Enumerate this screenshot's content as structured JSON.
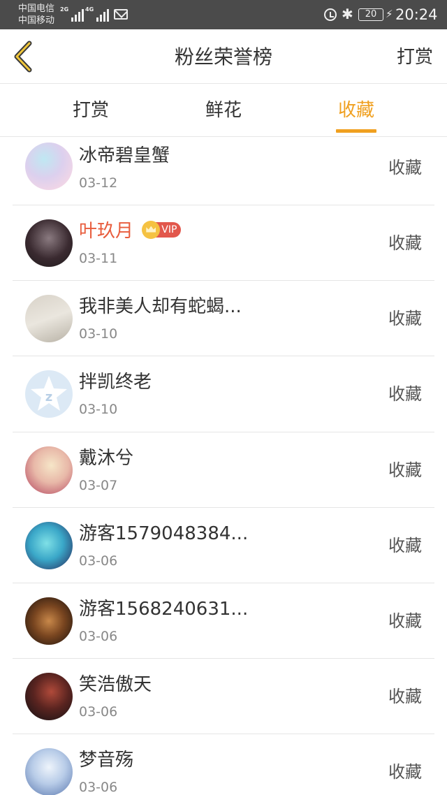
{
  "status_bar": {
    "carrier1": "中国电信",
    "carrier2": "中国移动",
    "net1": "2G",
    "net2": "4G",
    "battery": "20",
    "time": "20:24"
  },
  "header": {
    "title": "粉丝荣誉榜",
    "right_label": "打赏",
    "back_icon": "chevron-left-icon",
    "accent_color": "#f0a020"
  },
  "tabs": [
    {
      "label": "打赏",
      "active": false
    },
    {
      "label": "鲜花",
      "active": false
    },
    {
      "label": "收藏",
      "active": true
    }
  ],
  "list": [
    {
      "name": "冰帝碧皇蟹",
      "date": "03-12",
      "action": "收藏",
      "vip": false
    },
    {
      "name": "叶玖月",
      "date": "03-11",
      "action": "收藏",
      "vip": true,
      "vip_label": "VIP"
    },
    {
      "name": "我非美人却有蛇蝎...",
      "date": "03-10",
      "action": "收藏",
      "vip": false
    },
    {
      "name": "拌凯终老",
      "date": "03-10",
      "action": "收藏",
      "vip": false
    },
    {
      "name": "戴沐兮",
      "date": "03-07",
      "action": "收藏",
      "vip": false
    },
    {
      "name": "游客1579048384...",
      "date": "03-06",
      "action": "收藏",
      "vip": false
    },
    {
      "name": "游客1568240631...",
      "date": "03-06",
      "action": "收藏",
      "vip": false
    },
    {
      "name": "笑浩傲天",
      "date": "03-06",
      "action": "收藏",
      "vip": false
    },
    {
      "name": "梦音殇",
      "date": "03-06",
      "action": "收藏",
      "vip": false
    }
  ]
}
